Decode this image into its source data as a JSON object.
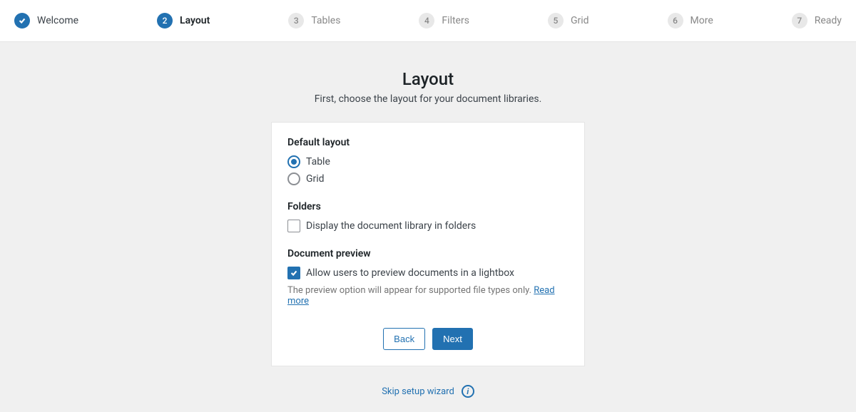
{
  "stepper": [
    {
      "num": "",
      "label": "Welcome",
      "state": "done"
    },
    {
      "num": "2",
      "label": "Layout",
      "state": "current"
    },
    {
      "num": "3",
      "label": "Tables",
      "state": "pending"
    },
    {
      "num": "4",
      "label": "Filters",
      "state": "pending"
    },
    {
      "num": "5",
      "label": "Grid",
      "state": "pending"
    },
    {
      "num": "6",
      "label": "More",
      "state": "pending"
    },
    {
      "num": "7",
      "label": "Ready",
      "state": "pending"
    }
  ],
  "page": {
    "title": "Layout",
    "subtitle": "First, choose the layout for your document libraries."
  },
  "sections": {
    "default_layout": {
      "title": "Default layout",
      "options": [
        {
          "label": "Table",
          "selected": true
        },
        {
          "label": "Grid",
          "selected": false
        }
      ]
    },
    "folders": {
      "title": "Folders",
      "checkbox_label": "Display the document library in folders",
      "checked": false
    },
    "preview": {
      "title": "Document preview",
      "checkbox_label": "Allow users to preview documents in a lightbox",
      "checked": true,
      "hint_prefix": "The preview option will appear for supported file types only. ",
      "hint_link": "Read more"
    }
  },
  "actions": {
    "back": "Back",
    "next": "Next"
  },
  "footer": {
    "skip": "Skip setup wizard"
  }
}
